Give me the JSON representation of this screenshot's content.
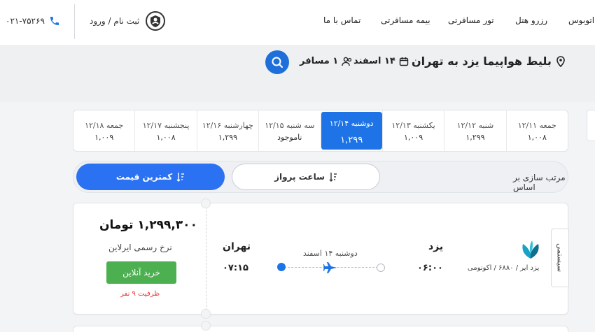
{
  "header": {
    "phone": "۰۲۱-۷۵۲۶۹",
    "login_label": "ثبت نام / ورود",
    "nav": {
      "contact": "تماس با ما",
      "insurance": "بیمه مسافرتی",
      "tour": "تور مسافرتی",
      "hotel": "رزرو هتل",
      "bus": "اتوبوس"
    }
  },
  "search": {
    "route": "بلیط هواپیما یزد به تهران",
    "date": "۱۴ اسفند",
    "passengers": "۱ مسافر"
  },
  "date_strip": [
    {
      "day": "جمعه ۱۲/۱۱",
      "price": "۱,۰۰۸",
      "active": false
    },
    {
      "day": "شنبه ۱۲/۱۲",
      "price": "۱,۲۹۹",
      "active": false
    },
    {
      "day": "یکشنبه ۱۲/۱۳",
      "price": "۱,۰۰۹",
      "active": false
    },
    {
      "day": "دوشنبه ۱۲/۱۴",
      "price": "۱,۲۹۹",
      "active": true
    },
    {
      "day": "سه شنبه ۱۲/۱۵",
      "price": "ناموجود",
      "active": false
    },
    {
      "day": "چهارشنبه ۱۲/۱۶",
      "price": "۱,۲۹۹",
      "active": false
    },
    {
      "day": "پنجشنبه ۱۲/۱۷",
      "price": "۱,۰۰۸",
      "active": false
    },
    {
      "day": "جمعه ۱۲/۱۸",
      "price": "۱,۰۰۹",
      "active": false
    }
  ],
  "sort": {
    "label": "مرتب سازی بر اساس",
    "by_time": "ساعت پرواز",
    "by_price": "کمترین قیمت"
  },
  "flight": {
    "price": "۱,۲۹۹,۳۰۰ تومان",
    "fare_note": "نرخ رسمی ایرلاین",
    "buy_label": "خرید آنلاین",
    "capacity": "ظرفیت ۹ نفر",
    "origin_city": "یزد",
    "origin_time": "۰۶:۰۰",
    "dest_city": "تهران",
    "dest_time": "۰۷:۱۵",
    "date": "دوشنبه ۱۴ اسفند",
    "airline_info": "یزد ایر / ۶۸۸۰ / اکونومی",
    "type_tag": "سیستمی"
  },
  "colors": {
    "primary": "#1e74e6",
    "buy": "#4caf50",
    "capacity": "#e53935"
  }
}
